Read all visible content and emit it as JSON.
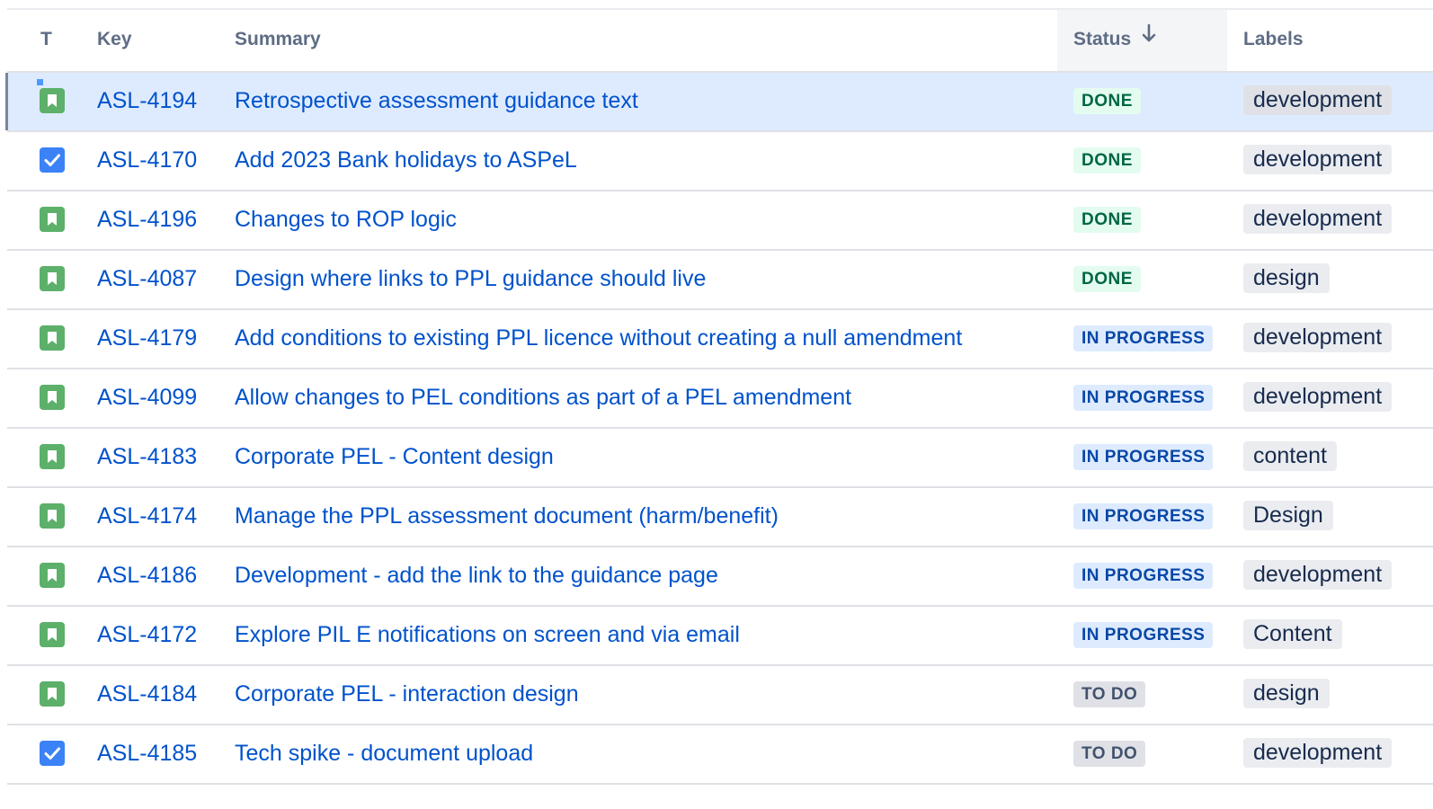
{
  "columns": {
    "type": "T",
    "key": "Key",
    "summary": "Summary",
    "status": "Status",
    "labels": "Labels"
  },
  "sort": {
    "column": "Status",
    "direction": "descending",
    "icon": "arrow-down-icon"
  },
  "colors": {
    "link": "#0052cc",
    "story_icon": "#5cb06a",
    "task_icon": "#3b82f6",
    "selected_row": "#deebff",
    "done_bg": "#e3fcef",
    "done_text": "#006644",
    "in_progress_bg": "#deebff",
    "in_progress_text": "#0747a6",
    "todo_bg": "#dfe1e6",
    "todo_text": "#42526e"
  },
  "issues": [
    {
      "type": "story",
      "key": "ASL-4194",
      "summary": "Retrospective assessment guidance text",
      "status": "DONE",
      "label": "development",
      "selected": true
    },
    {
      "type": "task",
      "key": "ASL-4170",
      "summary": "Add 2023 Bank holidays to ASPeL",
      "status": "DONE",
      "label": "development"
    },
    {
      "type": "story",
      "key": "ASL-4196",
      "summary": "Changes to ROP logic",
      "status": "DONE",
      "label": "development"
    },
    {
      "type": "story",
      "key": "ASL-4087",
      "summary": "Design where links to PPL guidance should live",
      "status": "DONE",
      "label": "design"
    },
    {
      "type": "story",
      "key": "ASL-4179",
      "summary": "Add conditions to existing PPL licence without creating a null amendment",
      "status": "IN PROGRESS",
      "label": "development"
    },
    {
      "type": "story",
      "key": "ASL-4099",
      "summary": "Allow changes to PEL conditions as part of a PEL amendment",
      "status": "IN PROGRESS",
      "label": "development"
    },
    {
      "type": "story",
      "key": "ASL-4183",
      "summary": "Corporate PEL - Content design",
      "status": "IN PROGRESS",
      "label": "content"
    },
    {
      "type": "story",
      "key": "ASL-4174",
      "summary": "Manage the PPL assessment document (harm/benefit)",
      "status": "IN PROGRESS",
      "label": "Design"
    },
    {
      "type": "story",
      "key": "ASL-4186",
      "summary": "Development - add the link to the guidance page",
      "status": "IN PROGRESS",
      "label": "development"
    },
    {
      "type": "story",
      "key": "ASL-4172",
      "summary": "Explore PIL E notifications on screen and via email",
      "status": "IN PROGRESS",
      "label": "Content"
    },
    {
      "type": "story",
      "key": "ASL-4184",
      "summary": "Corporate PEL - interaction design",
      "status": "TO DO",
      "label": "design"
    },
    {
      "type": "task",
      "key": "ASL-4185",
      "summary": "Tech spike - document upload",
      "status": "TO DO",
      "label": "development"
    }
  ]
}
